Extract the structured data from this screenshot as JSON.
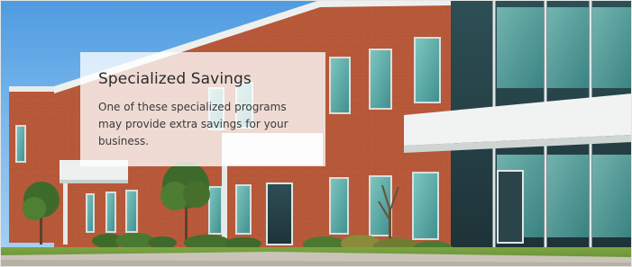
{
  "promo": {
    "title": "Specialized Savings",
    "body": "One of these specialized programs may provide extra savings for your business."
  },
  "photo": {
    "subject": "office-building-icon",
    "colors": {
      "sky": "#5fa6e6",
      "brick": "#b85a3a",
      "glass": "#5fa9a6",
      "trim": "#eef0ef",
      "lawn": "#6f9a3a"
    }
  }
}
